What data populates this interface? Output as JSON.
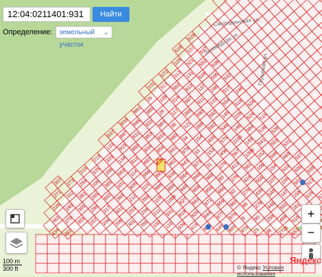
{
  "search": {
    "value": "12:04:0211401:931",
    "button_label": "Найти"
  },
  "definition": {
    "label": "Определение:",
    "selected": "земельный участок"
  },
  "streets": [
    "Смородиновая ул.",
    "Заповедная ул.",
    "Грушевая ул."
  ],
  "parcel_numbers": [
    "434",
    "462",
    "262",
    "226",
    "270",
    "271",
    "240",
    "303",
    "307",
    "302",
    "305",
    "257",
    "273",
    "391",
    "290",
    "204",
    "250",
    "265",
    "217",
    "209",
    "215",
    "200",
    "602",
    "601",
    "301",
    "375",
    "365",
    "360",
    "203",
    "355",
    "219",
    "206",
    "201",
    "212",
    "234",
    "330",
    "320",
    "603",
    "605",
    "350",
    "211",
    "110",
    "103",
    "134",
    "114",
    "116",
    "119",
    "931",
    "939",
    "937",
    "915",
    "912",
    "996",
    "998",
    "1004",
    "819",
    "818",
    "887",
    "890",
    "892",
    "893",
    "894",
    "827",
    "826",
    "826",
    "830",
    "831",
    "834",
    "836",
    "838",
    "840",
    "843",
    "844",
    "845",
    "846",
    "853",
    "856",
    "862",
    "864",
    "869",
    "871",
    "877",
    "880",
    "881",
    "932",
    "933",
    "941",
    "943",
    "948",
    "956",
    "959",
    "976",
    "978",
    "985",
    "983",
    "980",
    "979",
    "973",
    "968",
    "966",
    "960",
    "9",
    "23",
    "26",
    "28",
    "39",
    "34",
    "33",
    "31",
    "80",
    "82",
    "86",
    "90",
    "98",
    "101",
    "109",
    "117",
    "121",
    "154",
    "153",
    "276",
    "276",
    "276",
    "278",
    "259",
    "2726",
    "313",
    "314",
    "395",
    "398",
    "400",
    "406",
    "413",
    "424",
    "435",
    "448",
    "458",
    "553",
    "572",
    "582",
    "597",
    "590",
    "582",
    "575",
    "567",
    "561",
    "555",
    "548",
    "502",
    "510",
    "514",
    "513",
    "612",
    "611",
    "592",
    "545",
    "1103",
    "1009",
    "109",
    "107",
    "147",
    "161",
    "124",
    "126",
    "131",
    "137",
    "133",
    "145",
    "146",
    "149",
    "152",
    "154",
    "155",
    "158",
    "161",
    "504",
    "516",
    "521",
    "528",
    "246",
    "554",
    "226",
    "564",
    "541",
    "549",
    "510",
    "503",
    "516",
    "522",
    "537",
    "552",
    "505",
    "517",
    "518",
    "524",
    "538",
    "553",
    "469",
    "505",
    "513",
    "523",
    "529",
    "537",
    "536",
    "532",
    "246",
    "504",
    "515",
    "526",
    "531",
    "537",
    "509"
  ],
  "controls": {
    "fullscreen": "fullscreen-icon",
    "layers": "layers-icon",
    "zoom_in": "+",
    "zoom_out": "−",
    "person": "person-icon"
  },
  "scale": {
    "metric": "100 m",
    "imperial": "300 ft"
  },
  "copyright": {
    "brand": "© Яндекс",
    "terms": "Условия использования",
    "logo": "Яндекс"
  },
  "colors": {
    "parcel_outline": "#e03030",
    "highlight": "#f5e06a",
    "forest": "#b9d99a"
  }
}
